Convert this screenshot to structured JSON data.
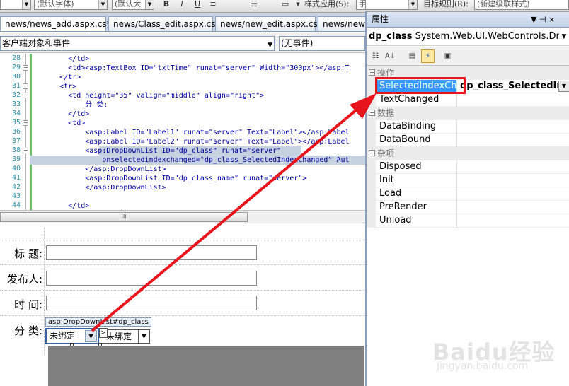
{
  "toolbar": {
    "font_combo": "(默认字体)",
    "size_combo": "(默认大",
    "bold": "B",
    "italic": "I",
    "underline": "U",
    "style_apply_label": "样式应用(S):",
    "style_apply_value": "手动",
    "target_rule_label": "目标规则(R):",
    "target_rule_value": "(新建级联样式)"
  },
  "tabs": [
    {
      "label": "news/news_add.aspx.cs*"
    },
    {
      "label": "news/Class_edit.aspx.cs"
    },
    {
      "label": "news/new_edit.aspx.cs"
    },
    {
      "label": "news/new"
    }
  ],
  "object_combos": {
    "left": "客户端对象和事件",
    "right": "(无事件)"
  },
  "code_lines": [
    {
      "no": "28",
      "text": "        </td>"
    },
    {
      "no": "29",
      "text": "        <td><asp:TextBox ID=\"txtTime\" runat=\"server\" Width=\"300px\"></asp:T"
    },
    {
      "no": "30",
      "text": "      </tr>"
    },
    {
      "no": "31",
      "text": "      <tr>"
    },
    {
      "no": "32",
      "text": "        <td height=\"35\" valign=\"middle\" align=\"right\">"
    },
    {
      "no": "33",
      "text": "            分 类:"
    },
    {
      "no": "34",
      "text": "        </td>"
    },
    {
      "no": "35",
      "text": "        <td>"
    },
    {
      "no": "36",
      "text": "            <asp:Label ID=\"Label1\" runat=\"server\" Text=\"Label\"></asp:Label"
    },
    {
      "no": "37",
      "text": "            <asp:Label ID=\"Label2\" runat=\"server\" Text=\"Label\"></asp:Label"
    },
    {
      "no": "38",
      "text": "            <asp:DropDownList ID=\"dp_class\" runat=\"server\""
    },
    {
      "no": "39",
      "text": "                onselectedindexchanged=\"dp_class_SelectedIndexChanged\" Aut"
    },
    {
      "no": "40",
      "text": "            </asp:DropDownList>"
    },
    {
      "no": "41",
      "text": "            <asp:DropDownList ID=\"dp_class_name\" runat=\"server\">"
    },
    {
      "no": "42",
      "text": "            </asp:DropDownList>"
    },
    {
      "no": "43",
      "text": ""
    },
    {
      "no": "44",
      "text": "        </td>"
    }
  ],
  "scroll_thumb": "III",
  "design": {
    "title_label": "标 题:",
    "author_label": "发布人:",
    "time_label": "时 间:",
    "category_label": "分 类:",
    "dropdown_tag": "asp:DropDownList#dp_class",
    "dropdown1_value": "未绑定",
    "dropdown2_value": "未绑定",
    "smart_tag": ">"
  },
  "properties": {
    "title": "属性",
    "pin": "▼ ⊣ ×",
    "object_name": "dp_class",
    "object_type": "System.Web.UI.WebControls.DropD",
    "categories": [
      {
        "name": "操作",
        "rows": [
          {
            "name": "SelectedIndexChan",
            "value": "dp_class_SelectedInde",
            "selected": true
          },
          {
            "name": "TextChanged",
            "value": ""
          }
        ]
      },
      {
        "name": "数据",
        "rows": [
          {
            "name": "DataBinding",
            "value": ""
          },
          {
            "name": "DataBound",
            "value": ""
          }
        ]
      },
      {
        "name": "杂项",
        "rows": [
          {
            "name": "Disposed",
            "value": ""
          },
          {
            "name": "Init",
            "value": ""
          },
          {
            "name": "Load",
            "value": ""
          },
          {
            "name": "PreRender",
            "value": ""
          },
          {
            "name": "Unload",
            "value": ""
          }
        ]
      }
    ]
  },
  "watermark": {
    "logo": "Baidu经验",
    "url": "jingyan.baidu.com"
  },
  "colors": {
    "arrow_red": "#e8141c",
    "selection_blue": "#3399ff",
    "code_highlight": "#c6d2e0"
  }
}
